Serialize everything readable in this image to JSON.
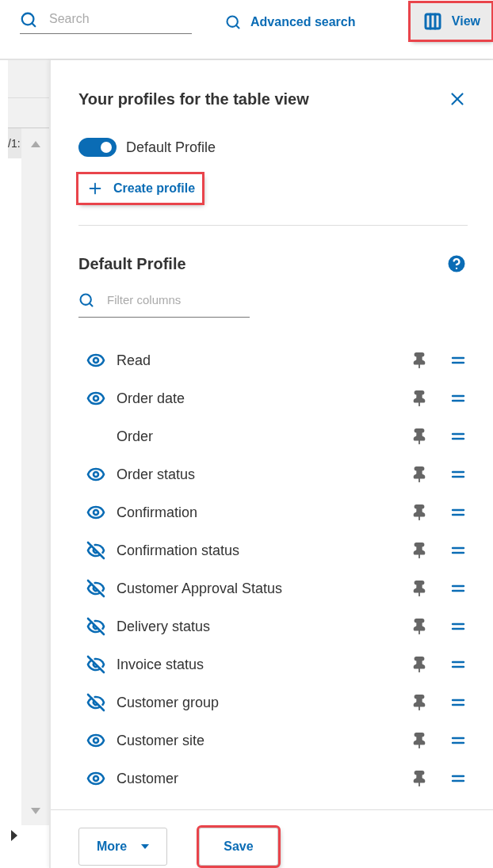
{
  "toolbar": {
    "search": {
      "placeholder": "Search"
    },
    "advanced_search": {
      "label": "Advanced search"
    },
    "view": {
      "label": "View",
      "highlighted": true
    }
  },
  "background_table": {
    "cell_text": "/1:"
  },
  "panel": {
    "title": "Your profiles for the table view",
    "profiles": [
      {
        "label": "Default Profile",
        "on": true
      }
    ],
    "create_profile": {
      "label": "Create profile",
      "highlighted": true
    },
    "profile_heading": "Default Profile",
    "filter": {
      "placeholder": "Filter columns"
    },
    "columns": [
      {
        "label": "Read",
        "kind": "shown"
      },
      {
        "label": "Order date",
        "kind": "shown"
      },
      {
        "label": "Order",
        "kind": "none"
      },
      {
        "label": "Order status",
        "kind": "shown"
      },
      {
        "label": "Confirmation",
        "kind": "shown"
      },
      {
        "label": "Confirmation status",
        "kind": "hidden"
      },
      {
        "label": "Customer Approval Status",
        "kind": "hidden"
      },
      {
        "label": "Delivery status",
        "kind": "hidden"
      },
      {
        "label": "Invoice status",
        "kind": "hidden"
      },
      {
        "label": "Customer group",
        "kind": "hidden"
      },
      {
        "label": "Customer site",
        "kind": "shown"
      },
      {
        "label": "Customer",
        "kind": "shown"
      }
    ],
    "footer": {
      "more": {
        "label": "More",
        "highlighted": false
      },
      "save": {
        "label": "Save",
        "highlighted": true
      }
    }
  }
}
